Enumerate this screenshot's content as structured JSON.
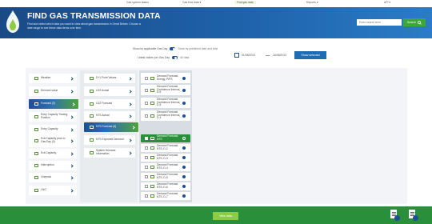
{
  "nav": {
    "items": [
      {
        "label": "Gas system status"
      },
      {
        "label": "Gas flow data ▾"
      },
      {
        "label": "Find gas data"
      },
      {
        "label": "Reports ▾"
      },
      {
        "label": "API ▾"
      }
    ]
  },
  "header": {
    "title": "FIND GAS TRANSMISSION DATA",
    "description": "Find and select which data you want to view about gas transmission in Great Britain. Choose a date range to see these data items over time.",
    "search_placeholder": "Enter search term",
    "search_button": "Search"
  },
  "options": {
    "applicable_label": "Show by applicable Gas Day",
    "applicable_value": "Show by published date and time",
    "latest_label": "Latest values per Gas Day",
    "latest_value": "All data",
    "date_from": "01/08/2023",
    "date_to": "16/08/2023",
    "submit_label": "Show selected"
  },
  "columns": {
    "col1": [
      {
        "label": "Weather"
      },
      {
        "label": "Demand value"
      },
      {
        "label": "Forecast (3)"
      },
      {
        "label": "Entry Capacity Trading Position"
      },
      {
        "label": "Entry Capacity"
      },
      {
        "label": "Exit Capacity prior to Gas Day (3)"
      },
      {
        "label": "Exit Capacity"
      },
      {
        "label": "Interruption"
      },
      {
        "label": "Linepack"
      },
      {
        "label": "LNG"
      }
    ],
    "col2": [
      {
        "label": "D+1 Point Values"
      },
      {
        "label": "LDZ Actual"
      },
      {
        "label": "LDZ Forecast"
      },
      {
        "label": "NTS Actual"
      },
      {
        "label": "NTS Forecast (6)"
      },
      {
        "label": "NTS Expected Demand"
      },
      {
        "label": "System Demand Information"
      }
    ],
    "col3": [
      {
        "label": "Demand Forecast, Energy, PIPS"
      },
      {
        "label": "Demand Forecast Confidence Interval, D-6"
      },
      {
        "label": "Demand Forecast Confidence Interval, D-5"
      },
      {
        "label": "Demand Forecast Confidence Interval, D-4"
      },
      {
        "label": "Demand Forecast, NTS"
      },
      {
        "label": "Demand Forecast, NTS, D-2"
      },
      {
        "label": "Demand Forecast, NTS, D-3"
      },
      {
        "label": "Demand Forecast, NTS, D-4"
      },
      {
        "label": "Demand Forecast, NTS, D-5"
      },
      {
        "label": "Demand Forecast, NTS, D-6"
      },
      {
        "label": "Demand Forecast, NTS, D-7"
      }
    ]
  },
  "footer": {
    "view_button": "View data"
  },
  "colors": {
    "banner": "#1e62aa",
    "accent_green": "#2a8f3a",
    "accent_blue": "#1d4f91"
  }
}
